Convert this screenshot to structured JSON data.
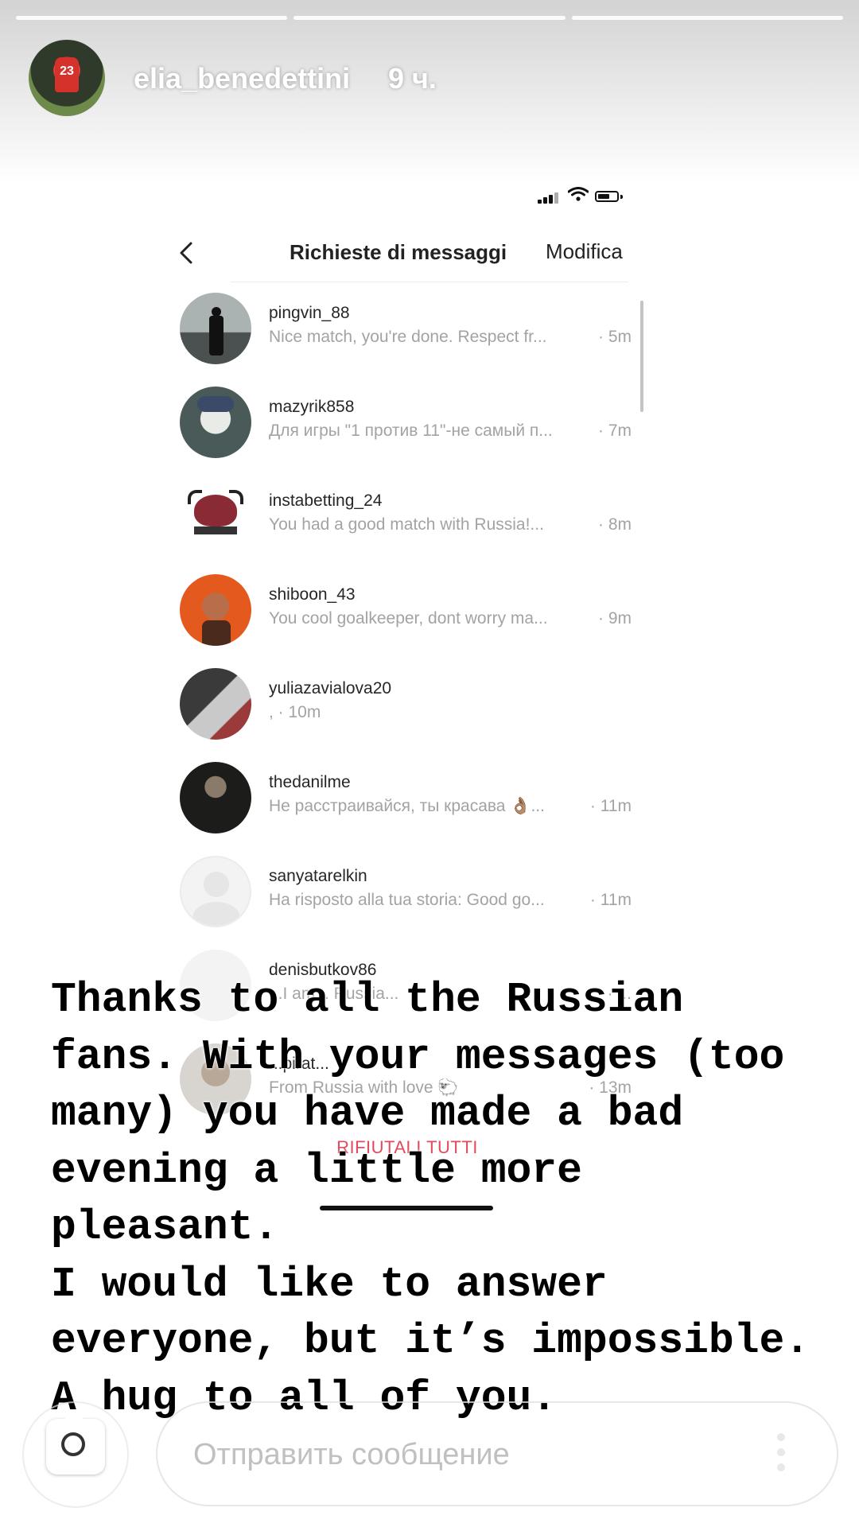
{
  "story": {
    "username": "elia_benedettini",
    "time_ago": "9 ч.",
    "avatar_number": "23"
  },
  "dm": {
    "title": "Richieste di messaggi",
    "edit_label": "Modifica",
    "back_icon": "chevron-left-icon",
    "requests": [
      {
        "username": "pingvin_88",
        "preview": "Nice match, you're done. Respect fr...",
        "time": "· 5m"
      },
      {
        "username": "mazyrik858",
        "preview": "Для игры \"1 против 11\"-не самый п...",
        "time": "· 7m"
      },
      {
        "username": "instabetting_24",
        "preview": "You had a good match with Russia!...",
        "time": "· 8m"
      },
      {
        "username": "shiboon_43",
        "preview": "You cool goalkeeper, dont worry ma...",
        "time": "· 9m"
      },
      {
        "username": "yuliazavialova20",
        "preview": ", · 10m",
        "time": ""
      },
      {
        "username": "thedanilme",
        "preview": "Не расстраивайся, ты красава 👌🏽...",
        "time": "· 11m"
      },
      {
        "username": "sanyatarelkin",
        "preview": "Ha risposto alla tua storia: Good go...",
        "time": "· 11m"
      },
      {
        "username": "denisbutkov86",
        "preview": "...I am... Russia...",
        "time": "· ..."
      },
      {
        "username": "...pirat...",
        "preview": "From Russia with love 🐑",
        "time": "· 13m"
      }
    ],
    "refuse_all_label": "RIFIUTALI TUTTI"
  },
  "caption": {
    "text": "Thanks to all the Russian fans. With your messages (too many) you have made a bad evening a little more pleasant.\nI would like to answer everyone, but it’s impossible. A hug to all of you."
  },
  "reply_bar": {
    "camera_icon": "camera-icon",
    "placeholder": "Отправить сообщение",
    "more_icon": "more-vertical-icon"
  }
}
